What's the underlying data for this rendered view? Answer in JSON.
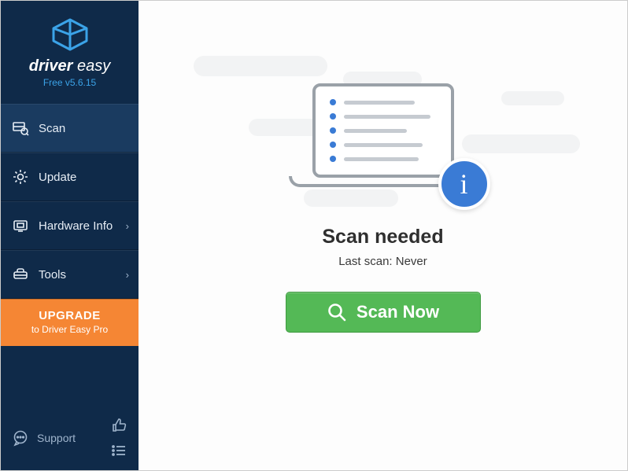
{
  "brand": {
    "name_a": "driver",
    "name_b": "easy",
    "version_label": "Free v5.6.15"
  },
  "sidebar": {
    "items": [
      {
        "label": "Scan",
        "icon": "scan-icon",
        "active": true,
        "chevron": false
      },
      {
        "label": "Update",
        "icon": "gear-icon",
        "active": false,
        "chevron": false
      },
      {
        "label": "Hardware Info",
        "icon": "hardware-icon",
        "active": false,
        "chevron": true
      },
      {
        "label": "Tools",
        "icon": "tools-icon",
        "active": false,
        "chevron": true
      }
    ],
    "upgrade_line1": "UPGRADE",
    "upgrade_line2": "to Driver Easy Pro",
    "support_label": "Support"
  },
  "main": {
    "heading": "Scan needed",
    "subtext": "Last scan: Never",
    "scan_button_label": "Scan Now"
  },
  "colors": {
    "sidebar_bg": "#0f2a49",
    "accent_blue": "#3a7bd5",
    "upgrade_orange": "#f58634",
    "scan_green": "#54b956"
  }
}
